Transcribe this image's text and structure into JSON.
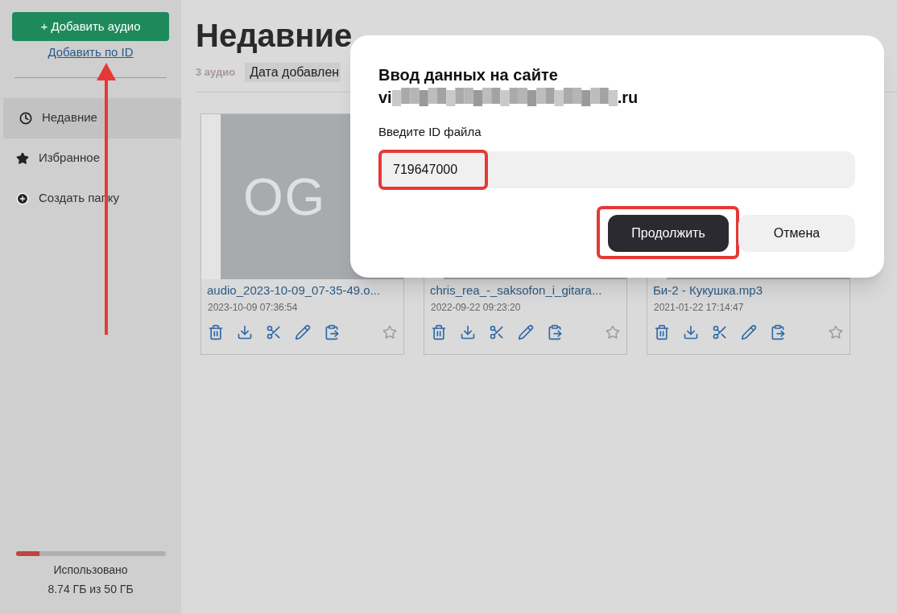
{
  "sidebar": {
    "add_button": "+ Добавить аудио",
    "add_by_id_link": "Добавить по ID",
    "items": [
      {
        "kind": "clock",
        "label": "Недавние",
        "selected": true
      },
      {
        "kind": "star",
        "label": "Избранное",
        "selected": false
      },
      {
        "kind": "plus",
        "label": "Создать папку",
        "selected": false
      }
    ],
    "storage": {
      "level": 0.16,
      "label": "Использовано",
      "usage": "8.74 ГБ из 50 ГБ"
    }
  },
  "main": {
    "title": "Недавние",
    "count": "3 аудио",
    "sort": "Дата добавлен",
    "cards": [
      {
        "title": "audio_2023-10-09_07-35-49.o...",
        "date": "2023-10-09 07:36:54",
        "thumbnail_text": "OG",
        "favorite": false
      },
      {
        "title": "chris_rea_-_saksofon_i_gitara...",
        "date": "2022-09-22 09:23:20",
        "favorite": false
      },
      {
        "title": "Би-2 - Кукушка.mp3",
        "date": "2021-01-22 17:14:47",
        "favorite": false
      }
    ]
  },
  "dialog": {
    "title": "Ввод данных на сайте",
    "site_start": "vi",
    "site_end": ".ru",
    "field_label": "Введите ID файла",
    "value": "719647000",
    "buttons": [
      {
        "kind": "primary",
        "label": "Продолжить"
      },
      {
        "kind": "secondary",
        "label": "Отмена"
      }
    ]
  }
}
